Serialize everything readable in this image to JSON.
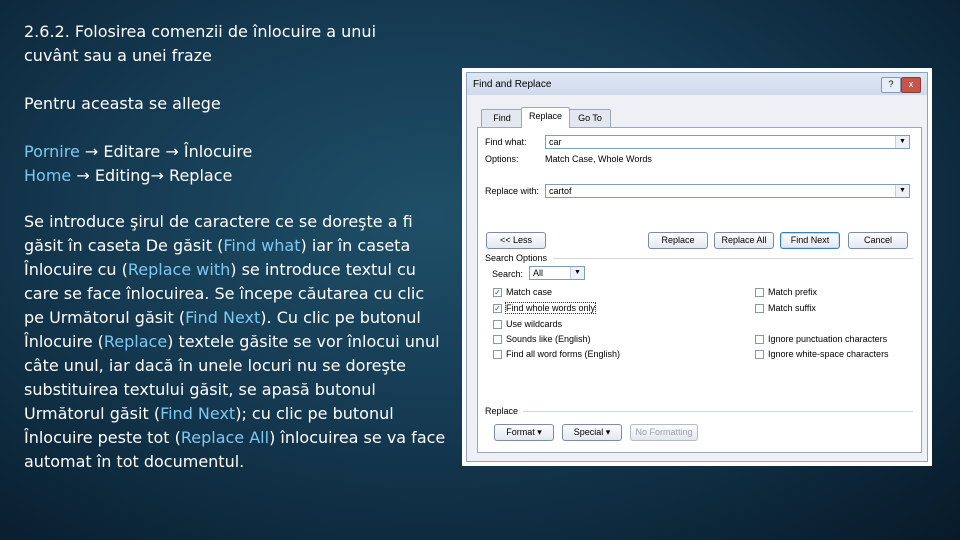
{
  "slide": {
    "heading_line1": "2.6.2. Folosirea comenzii de înlocuire a unui",
    "heading_line2": "cuvânt sau a unei fraze",
    "intro": "Pentru aceasta se allege",
    "path_ro": {
      "first": "Pornire",
      "rest": " → Editare → Înlocuire"
    },
    "path_en": {
      "first": "Home",
      "rest": " → Editing→ Replace"
    },
    "para": {
      "t1": " Se introduce şirul de caractere ce se doreşte a fi găsit în caseta De găsit (",
      "h1": "Find what",
      "t2": ") iar în caseta Înlocuire cu (",
      "h2": "Replace with",
      "t3": ") se introduce textul cu care se face înlocuirea. Se începe căutarea cu clic pe Următorul găsit (",
      "h3": "Find Next",
      "t4": "). Cu clic pe butonul Înlocuire (",
      "h4": "Replace",
      "t5": ") textele găsite se vor înlocui unul câte unul, iar dacă în unele locuri nu se doreşte substituirea textului găsit, se apasă butonul Următorul găsit (",
      "h5": "Find Next",
      "t6": "); cu clic pe butonul Înlocuire peste tot (",
      "h6": "Replace All",
      "t7": ") înlocuirea se va face automat în tot documentul."
    },
    "colors": {
      "highlight": "#7ec8f0",
      "background": "#153a52"
    }
  },
  "dialog": {
    "title": "Find and Replace",
    "help_glyph": "?",
    "close_glyph": "x",
    "tabs": [
      "Find",
      "Replace",
      "Go To"
    ],
    "find_what_label": "Find what:",
    "find_what_value": "car",
    "options_label": "Options:",
    "options_value": "Match Case, Whole Words",
    "replace_with_label": "Replace with:",
    "replace_with_value": "cartof",
    "buttons": {
      "less": "<< Less",
      "replace": "Replace",
      "replace_all": "Replace All",
      "find_next": "Find Next",
      "cancel": "Cancel",
      "format": "Format",
      "special": "Special",
      "no_formatting": "No Formatting"
    },
    "search_options_label": "Search Options",
    "search_label": "Search:",
    "search_value": "All",
    "checkboxes_left": [
      {
        "label": "Match case",
        "checked": true
      },
      {
        "label": "Find whole words only",
        "checked": true
      },
      {
        "label": "Use wildcards",
        "checked": false
      },
      {
        "label": "Sounds like (English)",
        "checked": false
      },
      {
        "label": "Find all word forms (English)",
        "checked": false
      }
    ],
    "checkboxes_right": [
      {
        "label": "Match prefix",
        "checked": false
      },
      {
        "label": "Match suffix",
        "checked": false
      },
      {
        "label": "Ignore punctuation characters",
        "checked": false
      },
      {
        "label": "Ignore white-space characters",
        "checked": false
      }
    ],
    "replace_group_label": "Replace",
    "dropdown_arrow": "▼",
    "check_glyph": "✓"
  }
}
